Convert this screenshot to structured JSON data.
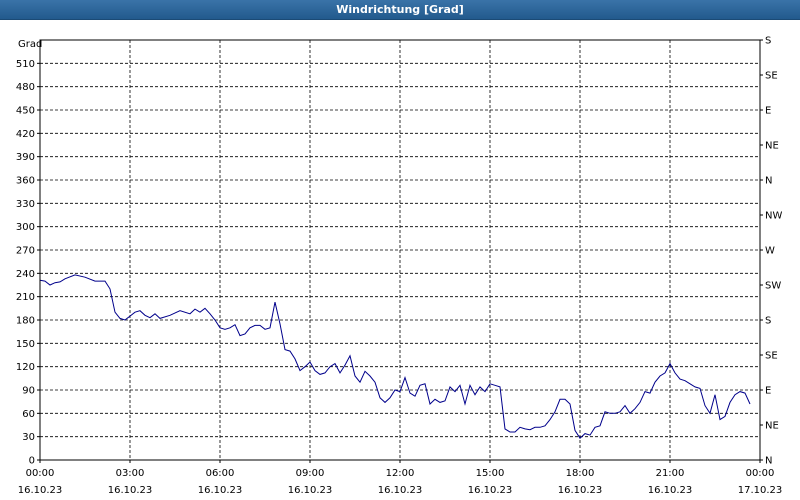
{
  "window": {
    "title": "Windrichtung [Grad]"
  },
  "colors": {
    "line": "#00008b",
    "grid": "#000000",
    "titlebar": "#2a639a"
  },
  "chart_data": {
    "type": "line",
    "title": "Windrichtung [Grad]",
    "ylabel": "Grad",
    "ylim": [
      0,
      540
    ],
    "xlim": [
      "16.10.23 00:00",
      "17.10.23 00:00"
    ],
    "grid": true,
    "left_ticks": [
      "0",
      "30",
      "60",
      "90",
      "120",
      "150",
      "180",
      "210",
      "240",
      "270",
      "300",
      "330",
      "360",
      "390",
      "420",
      "450",
      "480",
      "510"
    ],
    "right_ticks": [
      "N",
      "NE",
      "E",
      "SE",
      "S",
      "SW",
      "W",
      "NW",
      "N",
      "NE",
      "E",
      "SE",
      "S"
    ],
    "x_ticks": [
      {
        "time": "00:00",
        "date": "16.10.23"
      },
      {
        "time": "03:00",
        "date": "16.10.23"
      },
      {
        "time": "06:00",
        "date": "16.10.23"
      },
      {
        "time": "09:00",
        "date": "16.10.23"
      },
      {
        "time": "12:00",
        "date": "16.10.23"
      },
      {
        "time": "15:00",
        "date": "16.10.23"
      },
      {
        "time": "18:00",
        "date": "16.10.23"
      },
      {
        "time": "21:00",
        "date": "16.10.23"
      },
      {
        "time": "00:00",
        "date": "17.10.23"
      }
    ],
    "series": [
      {
        "points": [
          [
            "16.10.23 00:00",
            231
          ],
          [
            "16.10.23 00:10",
            230
          ],
          [
            "16.10.23 00:20",
            225
          ],
          [
            "16.10.23 00:30",
            228
          ],
          [
            "16.10.23 00:40",
            229
          ],
          [
            "16.10.23 00:50",
            233
          ],
          [
            "16.10.23 01:10",
            238
          ],
          [
            "16.10.23 01:30",
            235
          ],
          [
            "16.10.23 01:50",
            230
          ],
          [
            "16.10.23 02:10",
            230
          ],
          [
            "16.10.23 02:20",
            220
          ],
          [
            "16.10.23 02:30",
            190
          ],
          [
            "16.10.23 02:40",
            182
          ],
          [
            "16.10.23 02:50",
            180
          ],
          [
            "16.10.23 03:00",
            185
          ],
          [
            "16.10.23 03:10",
            190
          ],
          [
            "16.10.23 03:20",
            192
          ],
          [
            "16.10.23 03:30",
            186
          ],
          [
            "16.10.23 03:40",
            183
          ],
          [
            "16.10.23 03:50",
            188
          ],
          [
            "16.10.23 04:00",
            182
          ],
          [
            "16.10.23 04:20",
            186
          ],
          [
            "16.10.23 04:40",
            192
          ],
          [
            "16.10.23 05:00",
            188
          ],
          [
            "16.10.23 05:10",
            194
          ],
          [
            "16.10.23 05:20",
            190
          ],
          [
            "16.10.23 05:30",
            195
          ],
          [
            "16.10.23 05:40",
            188
          ],
          [
            "16.10.23 05:50",
            180
          ],
          [
            "16.10.23 06:00",
            170
          ],
          [
            "16.10.23 06:10",
            168
          ],
          [
            "16.10.23 06:20",
            170
          ],
          [
            "16.10.23 06:30",
            174
          ],
          [
            "16.10.23 06:40",
            160
          ],
          [
            "16.10.23 06:50",
            162
          ],
          [
            "16.10.23 07:00",
            170
          ],
          [
            "16.10.23 07:10",
            173
          ],
          [
            "16.10.23 07:20",
            173
          ],
          [
            "16.10.23 07:30",
            168
          ],
          [
            "16.10.23 07:40",
            170
          ],
          [
            "16.10.23 07:50",
            203
          ],
          [
            "16.10.23 08:00",
            175
          ],
          [
            "16.10.23 08:10",
            142
          ],
          [
            "16.10.23 08:20",
            140
          ],
          [
            "16.10.23 08:30",
            130
          ],
          [
            "16.10.23 08:40",
            115
          ],
          [
            "16.10.23 08:50",
            120
          ],
          [
            "16.10.23 09:00",
            126
          ],
          [
            "16.10.23 09:10",
            115
          ],
          [
            "16.10.23 09:20",
            110
          ],
          [
            "16.10.23 09:30",
            112
          ],
          [
            "16.10.23 09:40",
            120
          ],
          [
            "16.10.23 09:50",
            124
          ],
          [
            "16.10.23 10:00",
            112
          ],
          [
            "16.10.23 10:10",
            122
          ],
          [
            "16.10.23 10:20",
            134
          ],
          [
            "16.10.23 10:30",
            108
          ],
          [
            "16.10.23 10:40",
            100
          ],
          [
            "16.10.23 10:50",
            114
          ],
          [
            "16.10.23 11:00",
            108
          ],
          [
            "16.10.23 11:10",
            100
          ],
          [
            "16.10.23 11:20",
            80
          ],
          [
            "16.10.23 11:30",
            74
          ],
          [
            "16.10.23 11:40",
            80
          ],
          [
            "16.10.23 11:50",
            90
          ],
          [
            "16.10.23 12:00",
            88
          ],
          [
            "16.10.23 12:10",
            106
          ],
          [
            "16.10.23 12:20",
            86
          ],
          [
            "16.10.23 12:30",
            82
          ],
          [
            "16.10.23 12:40",
            96
          ],
          [
            "16.10.23 12:50",
            98
          ],
          [
            "16.10.23 13:00",
            72
          ],
          [
            "16.10.23 13:10",
            78
          ],
          [
            "16.10.23 13:20",
            74
          ],
          [
            "16.10.23 13:30",
            76
          ],
          [
            "16.10.23 13:40",
            94
          ],
          [
            "16.10.23 13:50",
            88
          ],
          [
            "16.10.23 14:00",
            96
          ],
          [
            "16.10.23 14:10",
            72
          ],
          [
            "16.10.23 14:20",
            96
          ],
          [
            "16.10.23 14:30",
            84
          ],
          [
            "16.10.23 14:40",
            94
          ],
          [
            "16.10.23 14:50",
            88
          ],
          [
            "16.10.23 15:00",
            98
          ],
          [
            "16.10.23 15:10",
            96
          ],
          [
            "16.10.23 15:20",
            94
          ],
          [
            "16.10.23 15:30",
            40
          ],
          [
            "16.10.23 15:40",
            36
          ],
          [
            "16.10.23 15:50",
            36
          ],
          [
            "16.10.23 16:00",
            42
          ],
          [
            "16.10.23 16:10",
            40
          ],
          [
            "16.10.23 16:20",
            39
          ],
          [
            "16.10.23 16:30",
            42
          ],
          [
            "16.10.23 16:40",
            42
          ],
          [
            "16.10.23 16:50",
            44
          ],
          [
            "16.10.23 17:00",
            52
          ],
          [
            "16.10.23 17:10",
            62
          ],
          [
            "16.10.23 17:20",
            78
          ],
          [
            "16.10.23 17:30",
            78
          ],
          [
            "16.10.23 17:40",
            72
          ],
          [
            "16.10.23 17:50",
            38
          ],
          [
            "16.10.23 18:00",
            28
          ],
          [
            "16.10.23 18:10",
            34
          ],
          [
            "16.10.23 18:20",
            32
          ],
          [
            "16.10.23 18:30",
            42
          ],
          [
            "16.10.23 18:40",
            44
          ],
          [
            "16.10.23 18:50",
            62
          ],
          [
            "16.10.23 19:00",
            60
          ],
          [
            "16.10.23 19:10",
            60
          ],
          [
            "16.10.23 19:20",
            62
          ],
          [
            "16.10.23 19:30",
            70
          ],
          [
            "16.10.23 19:40",
            60
          ],
          [
            "16.10.23 19:50",
            66
          ],
          [
            "16.10.23 20:00",
            74
          ],
          [
            "16.10.23 20:10",
            88
          ],
          [
            "16.10.23 20:20",
            86
          ],
          [
            "16.10.23 20:30",
            100
          ],
          [
            "16.10.23 20:40",
            108
          ],
          [
            "16.10.23 20:50",
            112
          ],
          [
            "16.10.23 21:00",
            124
          ],
          [
            "16.10.23 21:10",
            112
          ],
          [
            "16.10.23 21:20",
            104
          ],
          [
            "16.10.23 21:30",
            102
          ],
          [
            "16.10.23 21:40",
            98
          ],
          [
            "16.10.23 21:50",
            94
          ],
          [
            "16.10.23 22:00",
            92
          ],
          [
            "16.10.23 22:10",
            70
          ],
          [
            "16.10.23 22:20",
            60
          ],
          [
            "16.10.23 22:30",
            84
          ],
          [
            "16.10.23 22:40",
            52
          ],
          [
            "16.10.23 22:50",
            56
          ],
          [
            "16.10.23 23:00",
            74
          ],
          [
            "16.10.23 23:10",
            84
          ],
          [
            "16.10.23 23:20",
            88
          ],
          [
            "16.10.23 23:30",
            86
          ],
          [
            "16.10.23 23:40",
            72
          ]
        ]
      }
    ]
  }
}
